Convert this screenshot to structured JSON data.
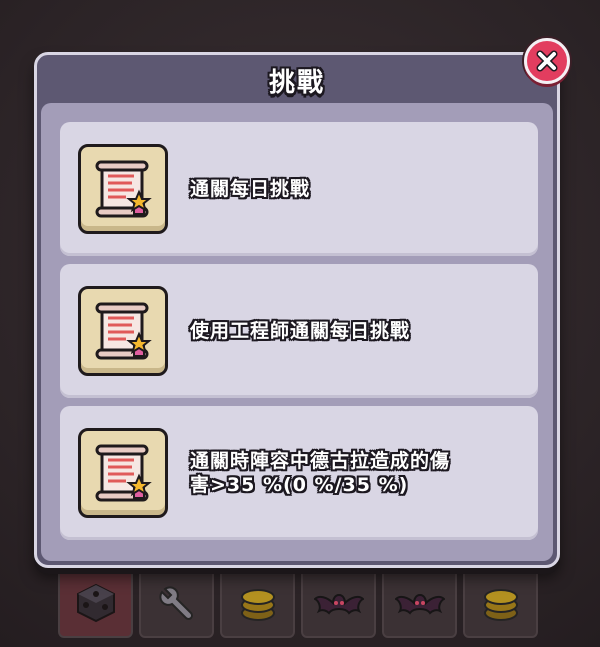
{
  "modal": {
    "title": "挑戰",
    "close_icon": "close-x-icon"
  },
  "tasks": [
    {
      "icon": "scroll-star-icon",
      "label": "通關每日挑戰"
    },
    {
      "icon": "scroll-star-icon",
      "label": "使用工程師通關每日挑戰"
    },
    {
      "icon": "scroll-star-icon",
      "label": "通關時陣容中德古拉造成的傷\n害>35 %(0 %/35 %)"
    }
  ],
  "background_slots": [
    {
      "icon": "dice-icon"
    },
    {
      "icon": "wrench-icon"
    },
    {
      "icon": "coin-stack-icon"
    },
    {
      "icon": "bat-icon"
    },
    {
      "icon": "bat-icon"
    },
    {
      "icon": "coin-stack-icon"
    }
  ],
  "colors": {
    "modal_border": "#d9d6e4",
    "modal_header": "#5d5872",
    "modal_body": "#a39db8",
    "card": "#d9d6e4",
    "close_button": "#e23d5f",
    "icon_frame": "#e8d9b0"
  }
}
